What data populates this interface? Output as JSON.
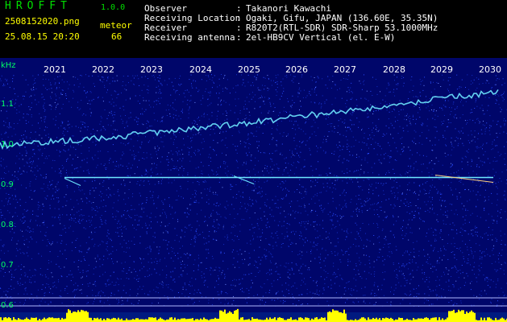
{
  "header": {
    "app_name": "HROFFT",
    "version": "1.0.0",
    "filename": "2508152020.png",
    "mode": "meteor",
    "datetime": "25.08.15 20:20",
    "count": "66",
    "info": [
      {
        "label": "Observer",
        "value": "Takanori Kawachi"
      },
      {
        "label": "Receiving Location",
        "value": "Ogaki, Gifu, JAPAN (136.60E, 35.35N)"
      },
      {
        "label": "Receiver",
        "value": "R820T2(RTL-SDR) SDR-Sharp 53.1000MHz"
      },
      {
        "label": "Receiving antenna",
        "value": "2el-HB9CV Vertical (el. E-W)"
      }
    ],
    "separator": ":"
  },
  "chart_data": {
    "type": "heatmap",
    "yunit": "kHz",
    "x_ticks": [
      "2021",
      "2022",
      "2023",
      "2024",
      "2025",
      "2026",
      "2027",
      "2028",
      "2029",
      "2030"
    ],
    "y_ticks": [
      "1.1",
      "1.0",
      "0.9",
      "0.8",
      "0.7",
      "0.6"
    ],
    "ylim": [
      0.58,
      1.18
    ],
    "reference_tone_khz": 0.915,
    "drift_trace_khz": {
      "start": 0.995,
      "end": 1.13
    },
    "colors": {
      "background": "#00066a",
      "noise": "#2a4cff",
      "trace": "#6ee8ff",
      "meter": "#ffff00",
      "axis_text": "#00ff66",
      "header_bg": "#000000"
    }
  }
}
